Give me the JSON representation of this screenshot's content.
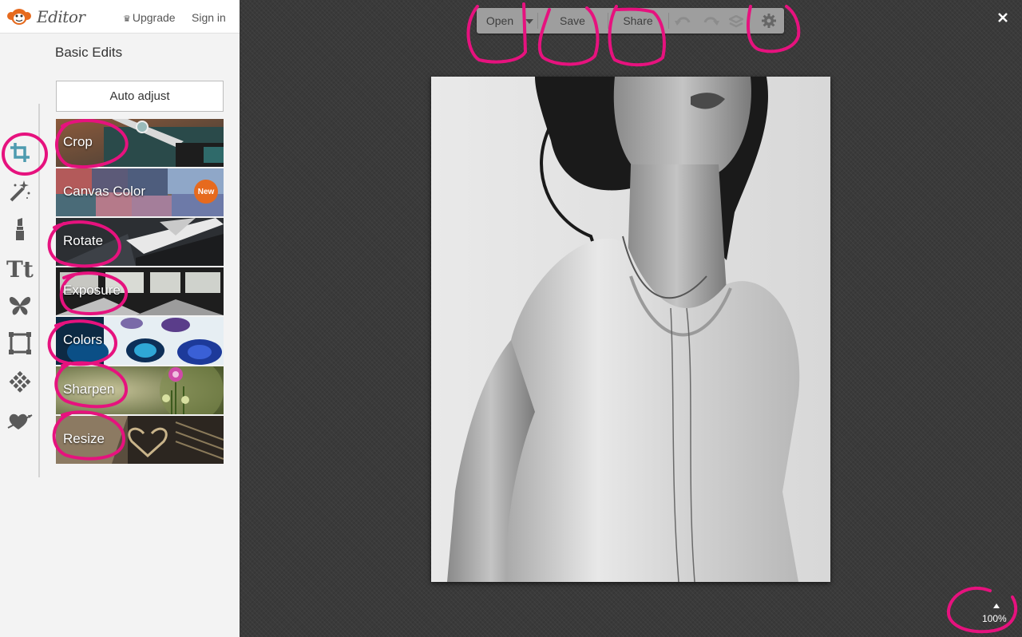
{
  "header": {
    "app_title": "Editor",
    "upgrade_label": "Upgrade",
    "signin_label": "Sign in"
  },
  "panel": {
    "title": "Basic Edits",
    "auto_adjust_label": "Auto adjust",
    "tools": [
      {
        "label": "Crop"
      },
      {
        "label": "Canvas Color",
        "badge": "New"
      },
      {
        "label": "Rotate"
      },
      {
        "label": "Exposure"
      },
      {
        "label": "Colors"
      },
      {
        "label": "Sharpen"
      },
      {
        "label": "Resize"
      }
    ]
  },
  "rail": {
    "icons": [
      "crop-icon",
      "magic-wand-icon",
      "lipstick-icon",
      "text-icon",
      "butterfly-icon",
      "frame-icon",
      "texture-icon",
      "heart-arrow-icon"
    ],
    "active": "crop-icon"
  },
  "toolbar": {
    "open_label": "Open",
    "save_label": "Save",
    "share_label": "Share",
    "icons": [
      "dropdown-arrow-icon",
      "undo-icon",
      "redo-icon",
      "layers-icon",
      "gear-icon"
    ]
  },
  "zoom": {
    "value": "100%"
  },
  "colors": {
    "accent": "#4e9bb0",
    "badge": "#e66a1e",
    "annotation": "#e6127e",
    "workspace": "#3a3a3a"
  }
}
